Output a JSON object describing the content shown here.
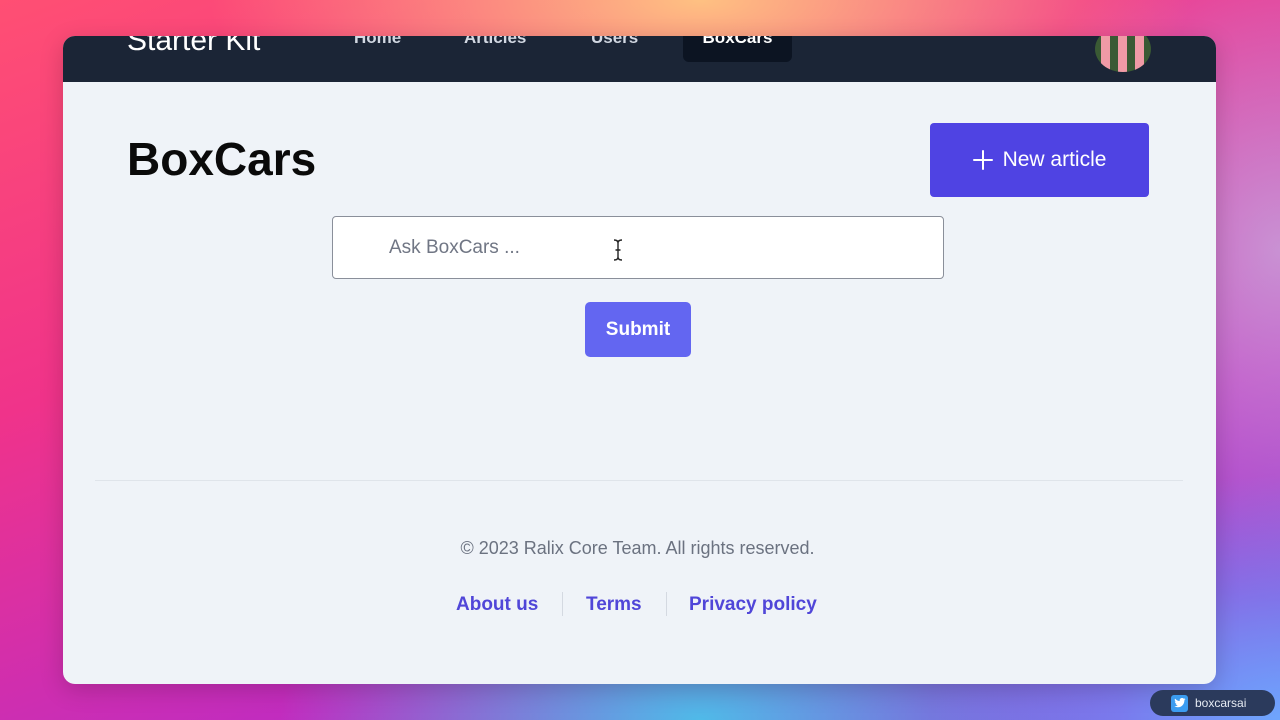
{
  "nav": {
    "brand": "Starter Kit",
    "links": [
      {
        "label": "Home"
      },
      {
        "label": "Articles"
      },
      {
        "label": "Users"
      },
      {
        "label": "BoxCars",
        "active": true
      }
    ],
    "avatar_icon": "user-avatar"
  },
  "main": {
    "title": "BoxCars",
    "new_article_label": "New article",
    "new_article_icon": "plus-icon",
    "ask_input": {
      "placeholder": "Ask BoxCars ...",
      "value": ""
    },
    "submit_label": "Submit"
  },
  "footer": {
    "copyright": "© 2023 Ralix Core Team. All rights reserved.",
    "links": [
      {
        "label": "About us"
      },
      {
        "label": "Terms"
      },
      {
        "label": "Privacy policy"
      }
    ]
  },
  "social": {
    "platform_icon": "twitter-icon",
    "handle": "boxcarsai"
  },
  "colors": {
    "navbar": "#1b2536",
    "primary_button": "#4f43e3",
    "submit_button": "#6366f1",
    "link": "#5046d8",
    "page_background": "#eff3f8"
  }
}
